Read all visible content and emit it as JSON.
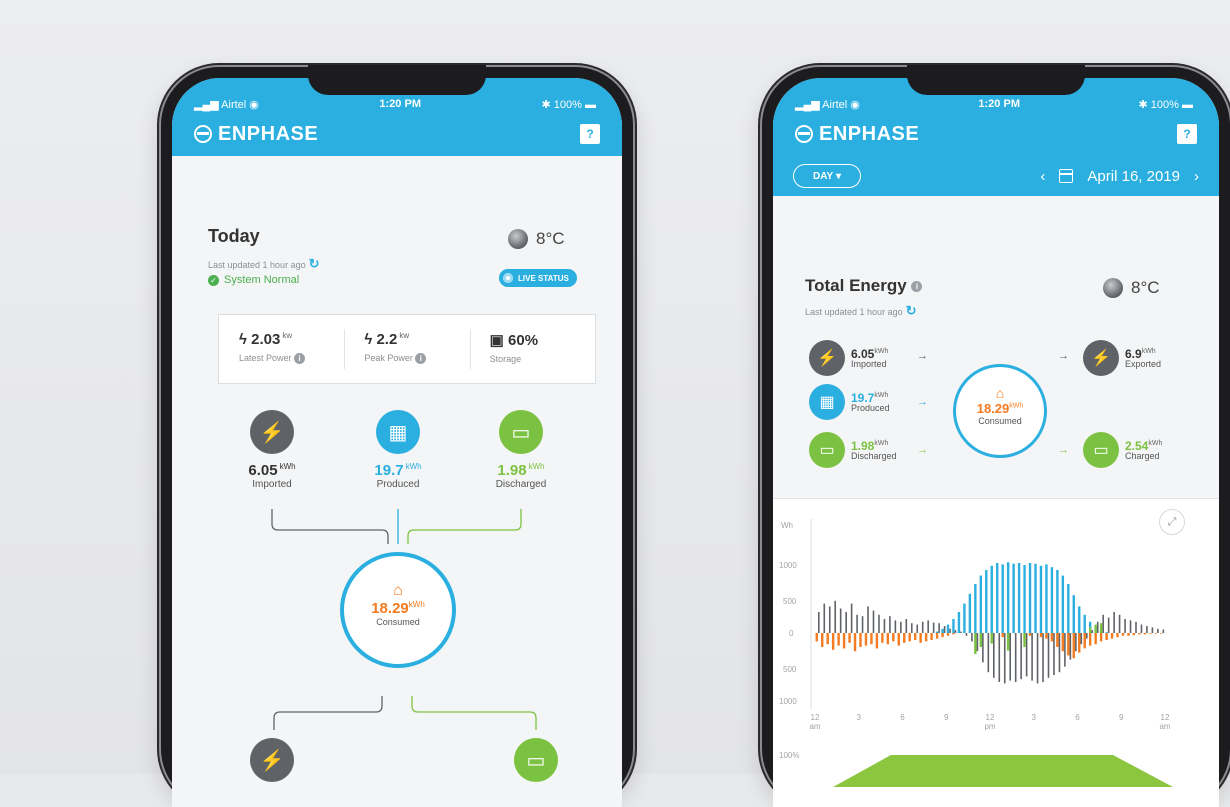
{
  "colors": {
    "accent": "#2aafe0",
    "imported": "#5f6368",
    "produced": "#2aafe0",
    "storage": "#7cc242",
    "consumed": "#f47b20"
  },
  "left_phone": {
    "status": {
      "carrier": "Airtel",
      "time": "1:20 PM",
      "battery": "100%"
    },
    "brand": "ENPHASE",
    "help": "?",
    "title": "Today",
    "updated": "Last updated 1 hour ago",
    "system_status": "System Normal",
    "temperature": "8°C",
    "live_status": "LIVE STATUS",
    "stats": [
      {
        "value": "2.03",
        "unit": "kw",
        "label": "Latest Power",
        "icon": "bolt-icon"
      },
      {
        "value": "2.2",
        "unit": "kw",
        "label": "Peak Power",
        "icon": "bolt-icon"
      },
      {
        "value": "60%",
        "unit": "",
        "label": "Storage",
        "icon": "battery-icon"
      }
    ],
    "nodes": [
      {
        "value": "6.05",
        "unit": "kWh",
        "label": "Imported",
        "icon": "grid-tower-icon"
      },
      {
        "value": "19.7",
        "unit": "kWh",
        "label": "Produced",
        "icon": "solar-panel-icon"
      },
      {
        "value": "1.98",
        "unit": "kWh",
        "label": "Discharged",
        "icon": "battery-icon"
      }
    ],
    "consumed": {
      "value": "18.29",
      "unit": "kWh",
      "label": "Consumed"
    }
  },
  "right_phone": {
    "status": {
      "carrier": "Airtel",
      "time": "1:20 PM",
      "battery": "100%"
    },
    "brand": "ENPHASE",
    "help": "?",
    "range": "DAY",
    "date": "April 16, 2019",
    "title": "Total Energy",
    "updated": "Last updated 1 hour ago",
    "temperature": "8°C",
    "left_items": [
      {
        "value": "6.05",
        "unit": "kWh",
        "label": "Imported",
        "icon": "grid-tower-icon"
      },
      {
        "value": "19.7",
        "unit": "kWh",
        "label": "Produced",
        "icon": "solar-panel-icon"
      },
      {
        "value": "1.98",
        "unit": "kWh",
        "label": "Discharged",
        "icon": "battery-icon"
      }
    ],
    "right_items": [
      {
        "value": "6.9",
        "unit": "kWh",
        "label": "Exported",
        "icon": "grid-tower-icon"
      },
      {
        "value": "2.54",
        "unit": "kWh",
        "label": "Charged",
        "icon": "battery-icon"
      }
    ],
    "consumed": {
      "value": "18.29",
      "unit": "kWh",
      "label": "Consumed"
    },
    "second_chart_label": "100%"
  },
  "chart_data": {
    "type": "bar",
    "ylabel": "Wh",
    "yticks": [
      "1000",
      "500",
      "0",
      "500",
      "1000"
    ],
    "ylim": [
      -1000,
      1000
    ],
    "xticks": [
      [
        "12",
        "am"
      ],
      [
        "3",
        ""
      ],
      [
        "6",
        ""
      ],
      [
        "9",
        ""
      ],
      [
        "12",
        "pm"
      ],
      [
        "3",
        ""
      ],
      [
        "6",
        ""
      ],
      [
        "9",
        ""
      ],
      [
        "12",
        "am"
      ]
    ],
    "series": [
      {
        "color": "#2aafe0",
        "values": [
          0,
          0,
          0,
          0,
          0,
          0,
          0,
          0,
          0,
          0,
          0,
          0,
          0,
          0,
          0,
          0,
          0,
          0,
          0,
          0,
          0,
          0,
          20,
          60,
          120,
          200,
          300,
          420,
          560,
          700,
          820,
          900,
          960,
          1000,
          980,
          1010,
          990,
          1000,
          970,
          1000,
          990,
          960,
          980,
          940,
          900,
          820,
          700,
          540,
          380,
          260,
          160,
          90,
          40,
          10,
          0,
          0,
          0,
          0,
          0,
          0,
          0,
          0,
          0,
          0
        ]
      },
      {
        "color": "#5f6368",
        "values": [
          300,
          420,
          380,
          460,
          350,
          300,
          420,
          260,
          240,
          380,
          320,
          260,
          200,
          240,
          180,
          160,
          200,
          140,
          120,
          160,
          180,
          150,
          140,
          100,
          60,
          40,
          20,
          -40,
          -120,
          -260,
          -420,
          -560,
          -640,
          -700,
          -720,
          -680,
          -700,
          -660,
          -620,
          -680,
          -720,
          -700,
          -640,
          -600,
          -560,
          -480,
          -380,
          -260,
          -160,
          -80,
          40,
          160,
          260,
          220,
          300,
          260,
          200,
          180,
          160,
          120,
          100,
          80,
          60,
          50
        ]
      },
      {
        "color": "#f47b20",
        "values": [
          -120,
          -200,
          -160,
          -240,
          -180,
          -220,
          -140,
          -260,
          -200,
          -180,
          -160,
          -220,
          -140,
          -160,
          -120,
          -180,
          -140,
          -120,
          -100,
          -140,
          -120,
          -100,
          -80,
          -60,
          -40,
          -20,
          0,
          0,
          0,
          0,
          0,
          0,
          0,
          0,
          -60,
          -80,
          0,
          0,
          -100,
          -40,
          0,
          -60,
          -80,
          -120,
          -200,
          -260,
          -320,
          -360,
          -280,
          -220,
          -180,
          -160,
          -120,
          -100,
          -80,
          -60,
          -40,
          -40,
          -30,
          -20,
          -20,
          -10,
          -10,
          -10
        ]
      },
      {
        "color": "#7cc242",
        "values": [
          0,
          0,
          0,
          0,
          0,
          0,
          0,
          0,
          0,
          0,
          0,
          0,
          0,
          0,
          0,
          0,
          0,
          0,
          0,
          0,
          0,
          0,
          0,
          0,
          0,
          0,
          0,
          0,
          0,
          -300,
          -200,
          0,
          -150,
          0,
          0,
          -250,
          0,
          0,
          -200,
          0,
          0,
          0,
          0,
          0,
          0,
          0,
          0,
          0,
          0,
          0,
          80,
          120,
          140,
          0,
          0,
          0,
          0,
          0,
          0,
          0,
          0,
          0,
          0,
          0
        ]
      }
    ]
  }
}
